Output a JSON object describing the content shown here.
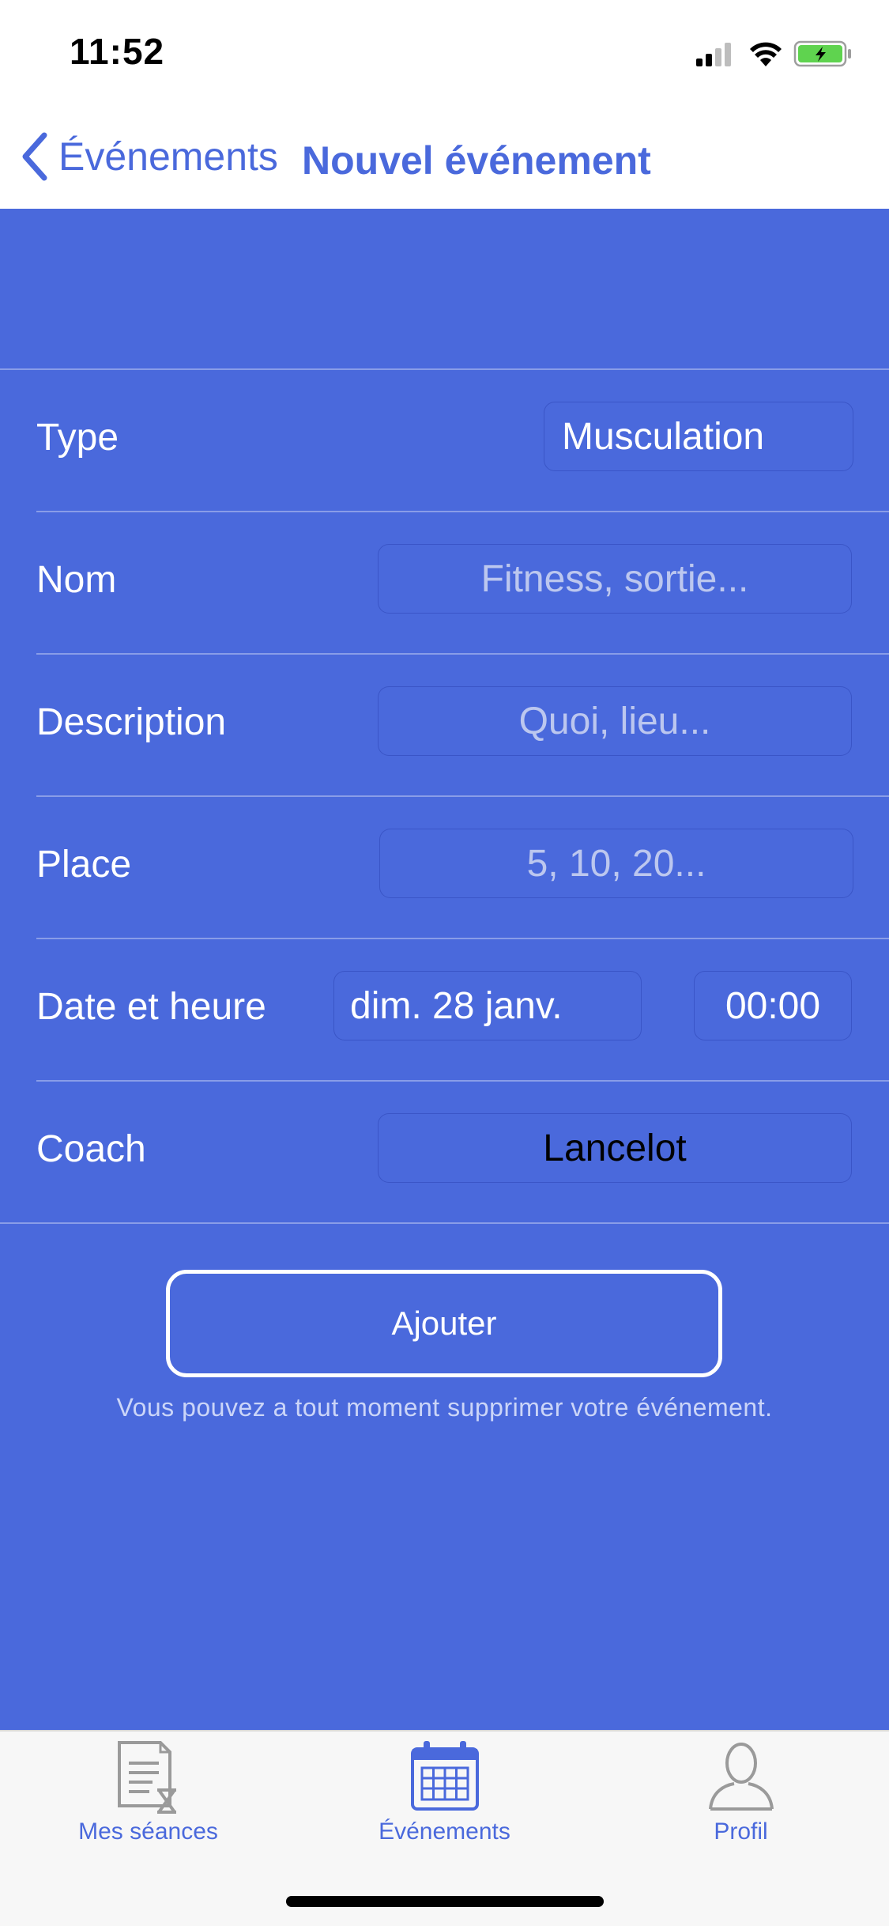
{
  "status": {
    "time": "11:52"
  },
  "nav": {
    "back_label": "Événements",
    "title": "Nouvel événement"
  },
  "form": {
    "type": {
      "label": "Type",
      "value": "Musculation"
    },
    "nom": {
      "label": "Nom",
      "placeholder": "Fitness, sortie..."
    },
    "description": {
      "label": "Description",
      "placeholder": "Quoi, lieu..."
    },
    "place": {
      "label": "Place",
      "placeholder": "5, 10, 20..."
    },
    "datetime": {
      "label": "Date et heure",
      "date": "dim. 28 janv.",
      "time": "00:00"
    },
    "coach": {
      "label": "Coach",
      "value": "Lancelot"
    }
  },
  "action": {
    "add_label": "Ajouter",
    "hint": "Vous pouvez a tout moment supprimer votre événement."
  },
  "tabs": [
    {
      "label": "Mes séances",
      "icon": "sessions-icon",
      "active": false
    },
    {
      "label": "Événements",
      "icon": "calendar-icon",
      "active": true
    },
    {
      "label": "Profil",
      "icon": "profile-icon",
      "active": false
    }
  ],
  "colors": {
    "accent": "#4A69DC",
    "background": "#4A69DC",
    "tabbar": "#F7F7F7",
    "battery": "#5FD34F"
  }
}
